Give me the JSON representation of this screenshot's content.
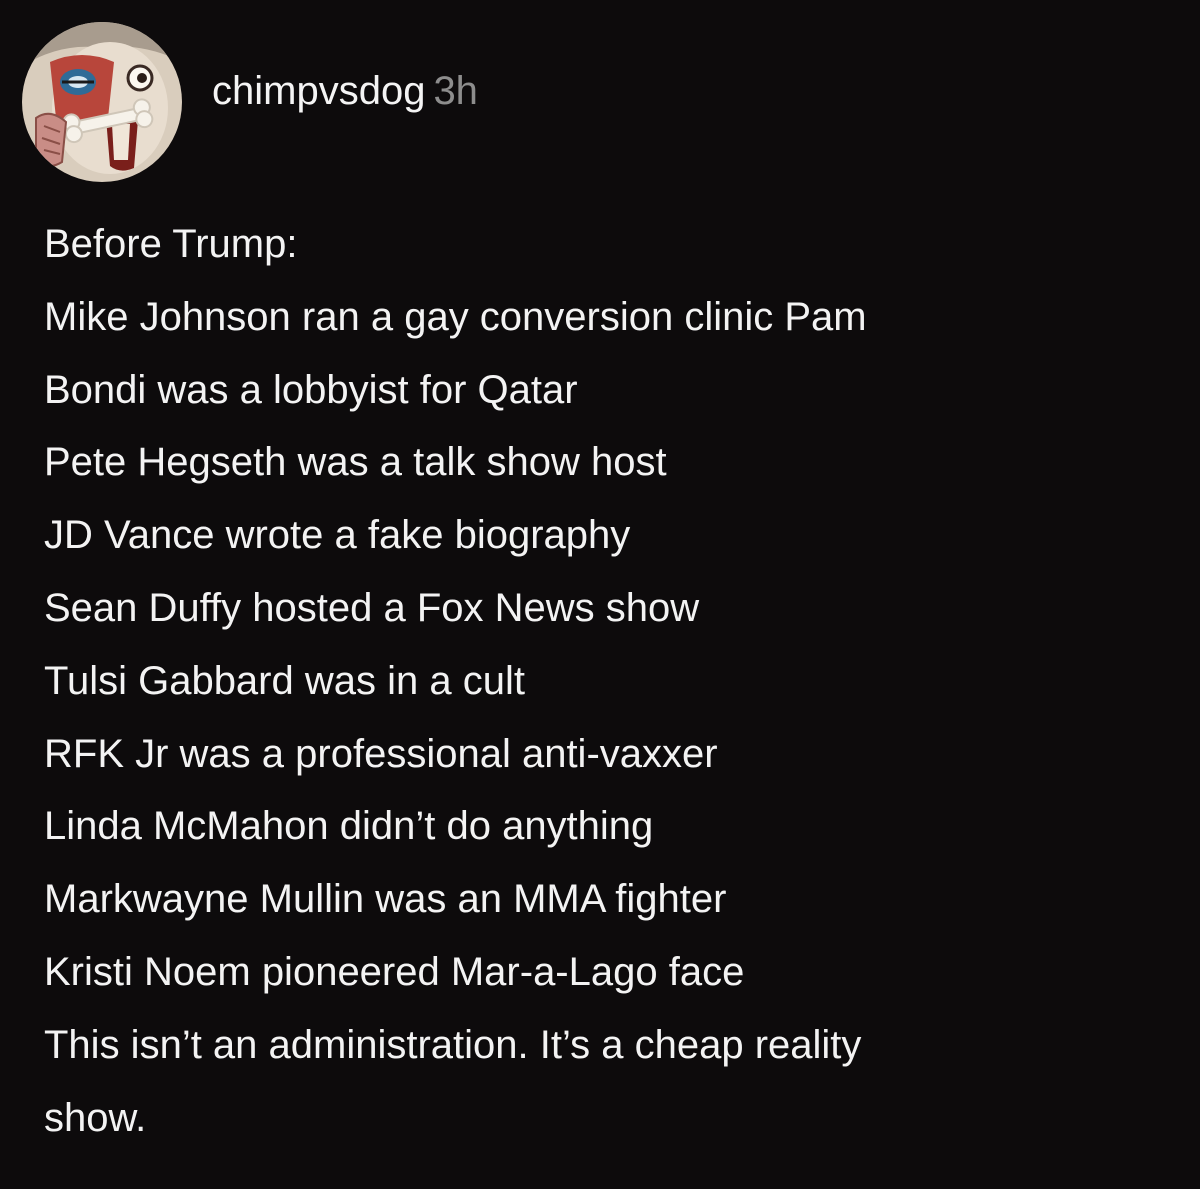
{
  "post": {
    "author": {
      "username": "chimpvsdog",
      "avatar_icon": "cartoon-face-avatar-icon"
    },
    "timestamp": "3h",
    "lines": [
      "Before Trump:",
      "Mike Johnson ran a gay conversion clinic Pam",
      "Bondi was a lobbyist for Qatar",
      "Pete Hegseth was a talk show host",
      "JD Vance wrote a fake biography",
      "Sean Duffy hosted a Fox News show",
      "Tulsi Gabbard was in a cult",
      "RFK Jr was a professional anti-vaxxer",
      "Linda McMahon didn’t do anything",
      "Markwayne Mullin was an MMA fighter",
      "Kristi Noem pioneered Mar-a-Lago face",
      "This isn’t an administration. It’s a cheap reality",
      "show."
    ]
  },
  "colors": {
    "background": "#0d0b0c",
    "text": "#f3f3f3",
    "timestamp": "#8d8d8d"
  }
}
